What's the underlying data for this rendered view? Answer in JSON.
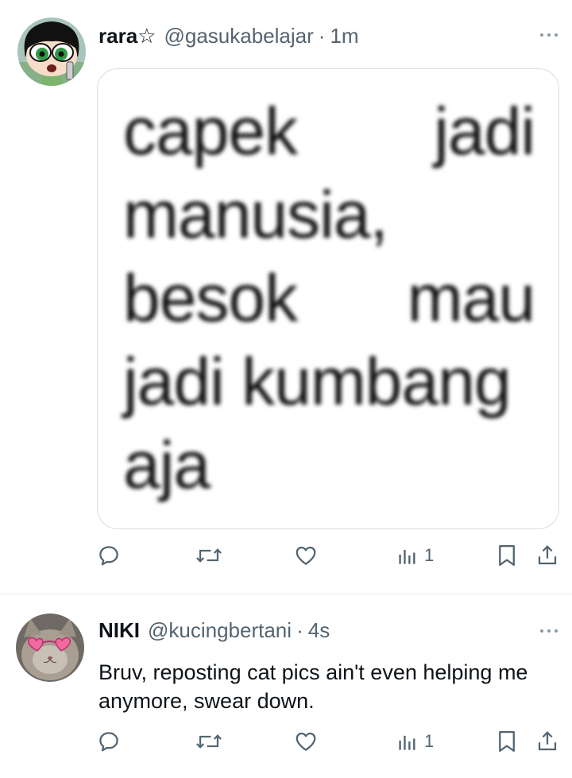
{
  "tweets": [
    {
      "display_name": "rara☆",
      "handle": "@gasukabelajar",
      "separator": "·",
      "time": "1m",
      "avatar": "powerpuff-girl-avatar",
      "media_text_lines": [
        [
          "capek",
          "jadi"
        ],
        [
          "manusia,"
        ],
        [
          "besok",
          "mau"
        ],
        [
          "jadi kumbang"
        ],
        [
          "aja"
        ]
      ],
      "views": "1"
    },
    {
      "display_name": "NIKI",
      "handle": "@kucingbertani",
      "separator": "·",
      "time": "4s",
      "avatar": "cat-with-heart-sunglasses-avatar",
      "text": "Bruv, reposting cat pics ain't even helping me anymore, swear down.",
      "views": "1"
    }
  ],
  "icons": {
    "reply": "reply-icon",
    "repost": "repost-icon",
    "like": "like-icon",
    "views": "views-icon",
    "bookmark": "bookmark-icon",
    "share": "share-icon",
    "more": "more-icon"
  },
  "colors": {
    "text": "#0f1419",
    "secondary": "#536471",
    "border": "#d9dee2"
  }
}
